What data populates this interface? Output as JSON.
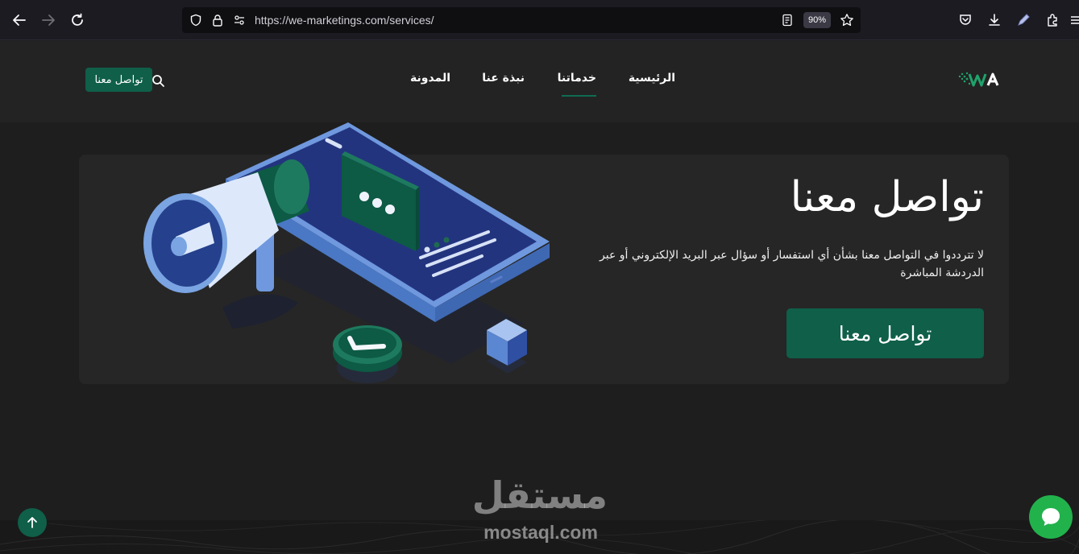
{
  "browser": {
    "url": "https://we-marketings.com/services/",
    "zoom": "90%",
    "icons": [
      "back-arrow-icon",
      "forward-arrow-icon",
      "reload-icon",
      "shield-icon",
      "lock-icon",
      "permissions-icon",
      "reader-view-icon",
      "bookmark-star-icon",
      "pocket-icon",
      "download-icon",
      "pen-icon",
      "extensions-icon",
      "menu-icon"
    ]
  },
  "header": {
    "nav": {
      "home": "الرئيسية",
      "services": "خدماتنا",
      "about": "نبذة عنا",
      "blog": "المدونة"
    },
    "active_nav": "services",
    "contact_button": "تواصل معنا",
    "accent_color": "#0f5f49"
  },
  "hero": {
    "title": "تواصل معنا",
    "description": "لا تترددوا في التواصل معنا بشأن أي استفسار أو سؤال عبر البريد الإلكتروني أو عبر الدردشة المباشرة",
    "cta": "تواصل معنا"
  },
  "watermark": {
    "arabic": "مستقل",
    "latin": "mostaql.com"
  },
  "floating": {
    "scroll_top_icon": "arrow-up-icon",
    "chat_icon": "chat-bubble-icon",
    "chat_color": "#22b24c"
  }
}
